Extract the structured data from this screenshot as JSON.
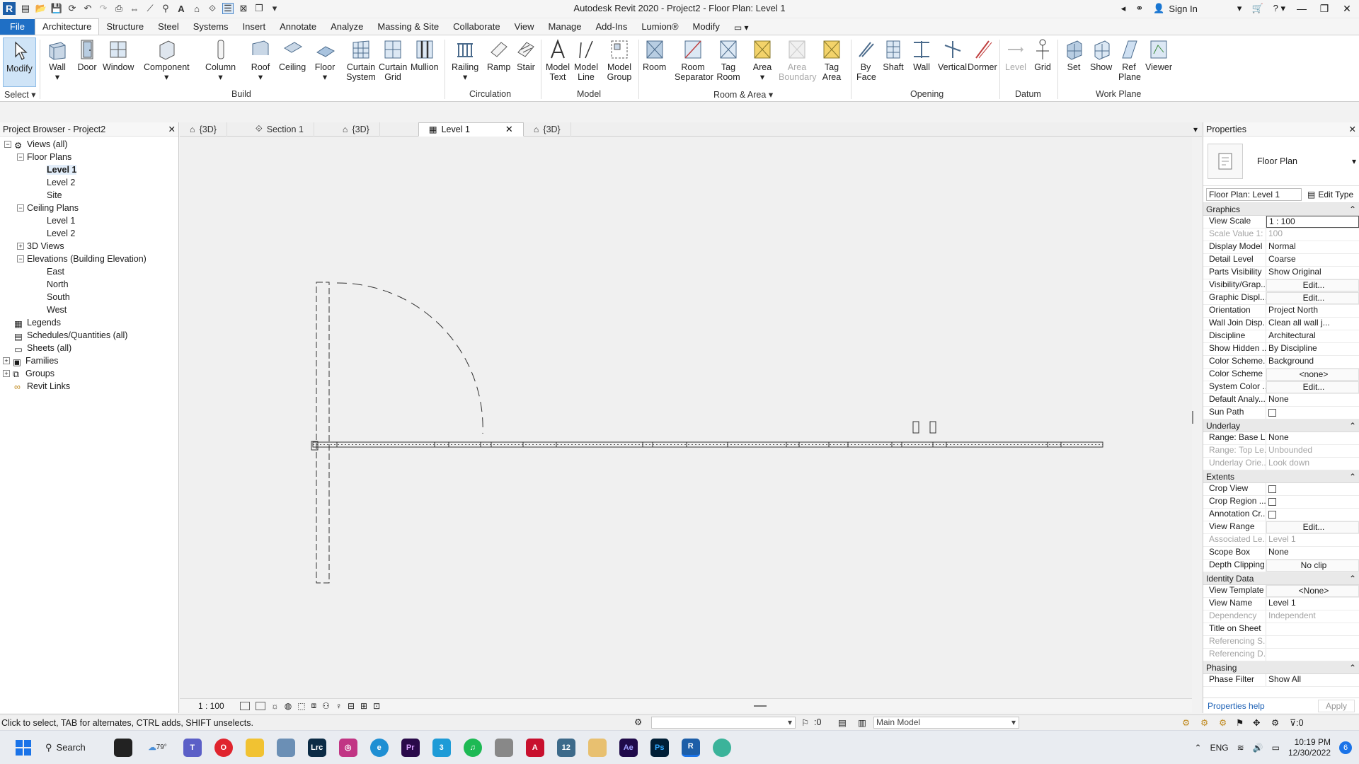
{
  "window": {
    "title": "Autodesk Revit 2020 - Project2 - Floor Plan: Level 1",
    "sign_in": "Sign In"
  },
  "ribbon_tabs": [
    "File",
    "Architecture",
    "Structure",
    "Steel",
    "Systems",
    "Insert",
    "Annotate",
    "Analyze",
    "Massing & Site",
    "Collaborate",
    "View",
    "Manage",
    "Add-Ins",
    "Lumion®",
    "Modify"
  ],
  "ribbon": {
    "modify": "Modify",
    "select_group": "Select",
    "build": {
      "label": "Build",
      "items": [
        "Wall",
        "Door",
        "Window",
        "Component",
        "Column",
        "Roof",
        "Ceiling",
        "Floor",
        "Curtain System",
        "Curtain Grid",
        "Mullion"
      ]
    },
    "circulation": {
      "label": "Circulation",
      "items": [
        "Railing",
        "Ramp",
        "Stair"
      ]
    },
    "model": {
      "label": "Model",
      "items": [
        "Model Text",
        "Model Line",
        "Model Group"
      ]
    },
    "room_area": {
      "label": "Room & Area",
      "items": [
        "Room",
        "Room Separator",
        "Tag Room",
        "Area",
        "Area Boundary",
        "Tag Area"
      ]
    },
    "opening": {
      "label": "Opening",
      "items": [
        "By Face",
        "Shaft",
        "Wall",
        "Vertical",
        "Dormer"
      ]
    },
    "datum": {
      "label": "Datum",
      "items": [
        "Level",
        "Grid"
      ]
    },
    "work_plane": {
      "label": "Work Plane",
      "items": [
        "Set",
        "Show",
        "Ref Plane",
        "Viewer"
      ]
    }
  },
  "project_browser": {
    "title": "Project Browser - Project2",
    "tree": {
      "views_all": "Views (all)",
      "floor_plans": "Floor Plans",
      "fp_level1": "Level 1",
      "fp_level2": "Level 2",
      "fp_site": "Site",
      "ceiling_plans": "Ceiling Plans",
      "cp_level1": "Level 1",
      "cp_level2": "Level 2",
      "views_3d": "3D Views",
      "elevations": "Elevations (Building Elevation)",
      "east": "East",
      "north": "North",
      "south": "South",
      "west": "West",
      "legends": "Legends",
      "schedules": "Schedules/Quantities (all)",
      "sheets": "Sheets (all)",
      "families": "Families",
      "groups": "Groups",
      "revit_links": "Revit Links"
    }
  },
  "view_tabs": [
    "{3D}",
    "Section 1",
    "{3D}",
    "Level 1",
    "{3D}"
  ],
  "view_control": {
    "scale": "1 : 100"
  },
  "properties": {
    "title": "Properties",
    "type_name": "Floor Plan",
    "instance_selector": "Floor Plan: Level 1",
    "edit_type": "Edit Type",
    "categories": {
      "graphics": "Graphics",
      "underlay": "Underlay",
      "extents": "Extents",
      "identity": "Identity Data",
      "phasing": "Phasing"
    },
    "graphics": [
      {
        "k": "View Scale",
        "v": "1 : 100"
      },
      {
        "k": "Scale Value    1:",
        "v": "100"
      },
      {
        "k": "Display Model",
        "v": "Normal"
      },
      {
        "k": "Detail Level",
        "v": "Coarse"
      },
      {
        "k": "Parts Visibility",
        "v": "Show Original"
      },
      {
        "k": "Visibility/Grap...",
        "v": "Edit..."
      },
      {
        "k": "Graphic Displ...",
        "v": "Edit..."
      },
      {
        "k": "Orientation",
        "v": "Project North"
      },
      {
        "k": "Wall Join Disp...",
        "v": "Clean all wall j..."
      },
      {
        "k": "Discipline",
        "v": "Architectural"
      },
      {
        "k": "Show Hidden ...",
        "v": "By Discipline"
      },
      {
        "k": "Color Scheme...",
        "v": "Background"
      },
      {
        "k": "Color Scheme",
        "v": "<none>"
      },
      {
        "k": "System Color ...",
        "v": "Edit..."
      },
      {
        "k": "Default Analy...",
        "v": "None"
      },
      {
        "k": "Sun Path",
        "v": ""
      }
    ],
    "underlay": [
      {
        "k": "Range: Base L...",
        "v": "None"
      },
      {
        "k": "Range: Top Le...",
        "v": "Unbounded"
      },
      {
        "k": "Underlay Orie...",
        "v": "Look down"
      }
    ],
    "extents": [
      {
        "k": "Crop View",
        "v": ""
      },
      {
        "k": "Crop Region ...",
        "v": ""
      },
      {
        "k": "Annotation Cr...",
        "v": ""
      },
      {
        "k": "View Range",
        "v": "Edit..."
      },
      {
        "k": "Associated Le...",
        "v": "Level 1"
      },
      {
        "k": "Scope Box",
        "v": "None"
      },
      {
        "k": "Depth Clipping",
        "v": "No clip"
      }
    ],
    "identity": [
      {
        "k": "View Template",
        "v": "<None>"
      },
      {
        "k": "View Name",
        "v": "Level 1"
      },
      {
        "k": "Dependency",
        "v": "Independent"
      },
      {
        "k": "Title on Sheet",
        "v": ""
      },
      {
        "k": "Referencing S...",
        "v": ""
      },
      {
        "k": "Referencing D...",
        "v": ""
      }
    ],
    "phasing": [
      {
        "k": "Phase Filter",
        "v": "Show All"
      }
    ],
    "help": "Properties help",
    "apply": "Apply"
  },
  "status": {
    "message": "Click to select, TAB for alternates, CTRL adds, SHIFT unselects.",
    "count": ":0",
    "model": "Main Model",
    "filter": ":0"
  },
  "taskbar": {
    "search": "Search",
    "weather": "79°",
    "lang": "ENG",
    "time": "10:19 PM",
    "date": "12/30/2022",
    "notifications": "6"
  }
}
